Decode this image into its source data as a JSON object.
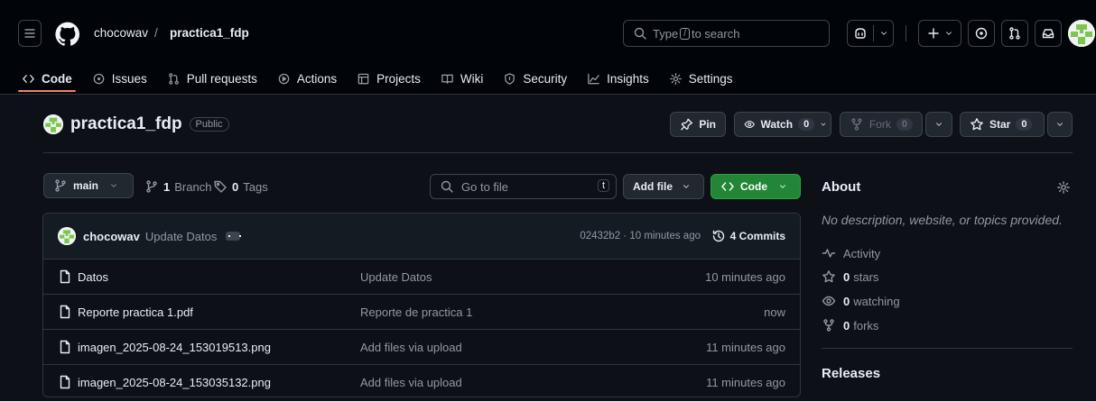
{
  "header": {
    "owner": "chocowav",
    "separator": "/",
    "repo": "practica1_fdp",
    "search_prefix": "Type",
    "search_key": "/",
    "search_suffix": "to search"
  },
  "nav": [
    {
      "label": "Code",
      "icon": "code-icon"
    },
    {
      "label": "Issues",
      "icon": "issue-icon"
    },
    {
      "label": "Pull requests",
      "icon": "pull-request-icon"
    },
    {
      "label": "Actions",
      "icon": "play-icon"
    },
    {
      "label": "Projects",
      "icon": "table-icon"
    },
    {
      "label": "Wiki",
      "icon": "book-icon"
    },
    {
      "label": "Security",
      "icon": "shield-icon"
    },
    {
      "label": "Insights",
      "icon": "graph-icon"
    },
    {
      "label": "Settings",
      "icon": "gear-icon"
    }
  ],
  "repo_head": {
    "name": "practica1_fdp",
    "visibility": "Public",
    "pin": "Pin",
    "watch": "Watch",
    "watch_count": "0",
    "fork": "Fork",
    "fork_count": "0",
    "star": "Star",
    "star_count": "0"
  },
  "toolbar": {
    "branch": "main",
    "branch_count": "1",
    "branch_label": "Branch",
    "tag_count": "0",
    "tag_label": "Tags",
    "goto_placeholder": "Go to file",
    "goto_key": "t",
    "add_file": "Add file",
    "code": "Code"
  },
  "latest_commit": {
    "author": "chocowav",
    "message": "Update Datos",
    "hash_time": "02432b2 · 10 minutes ago",
    "commits": "4 Commits"
  },
  "files": [
    {
      "name": "Datos",
      "message": "Update Datos",
      "date": "10 minutes ago"
    },
    {
      "name": "Reporte practica 1.pdf",
      "message": "Reporte de practica 1",
      "date": "now"
    },
    {
      "name": "imagen_2025-08-24_153019513.png",
      "message": "Add files via upload",
      "date": "11 minutes ago"
    },
    {
      "name": "imagen_2025-08-24_153035132.png",
      "message": "Add files via upload",
      "date": "11 minutes ago"
    }
  ],
  "about": {
    "title": "About",
    "description": "No description, website, or topics provided.",
    "activity": "Activity",
    "stars_count": "0",
    "stars_label": "stars",
    "watching_count": "0",
    "watching_label": "watching",
    "forks_count": "0",
    "forks_label": "forks",
    "releases": "Releases"
  },
  "colors": {
    "accent_green": "#238636",
    "underline": "#f78166",
    "bg": "#0d1117"
  }
}
